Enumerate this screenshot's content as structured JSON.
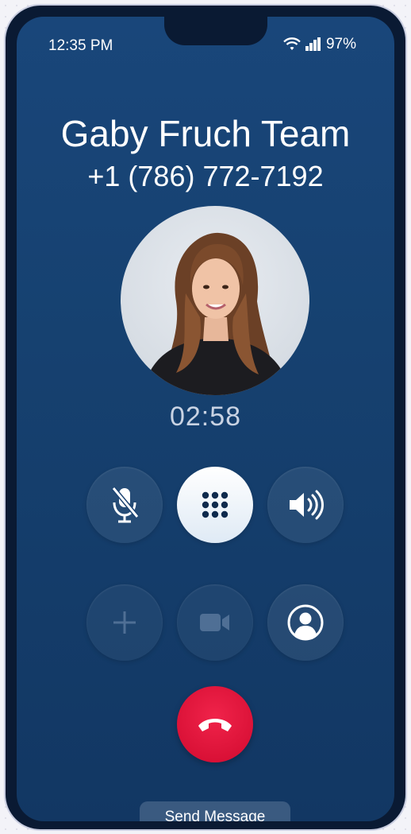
{
  "status_bar": {
    "time": "12:35 PM",
    "battery": "97%"
  },
  "call": {
    "caller_name": "Gaby Fruch Team",
    "caller_number": "+1 (786) 772-7192",
    "duration": "02:58"
  },
  "controls": {
    "row1": [
      "mute-mic-icon",
      "keypad-icon",
      "speaker-icon"
    ],
    "row2": [
      "add-call-icon",
      "video-icon",
      "contact-icon"
    ]
  },
  "actions": {
    "send_message": "Send Message"
  },
  "colors": {
    "screen_bg": "#164170",
    "end_call": "#e5163d",
    "active_button": "#ffffff"
  }
}
